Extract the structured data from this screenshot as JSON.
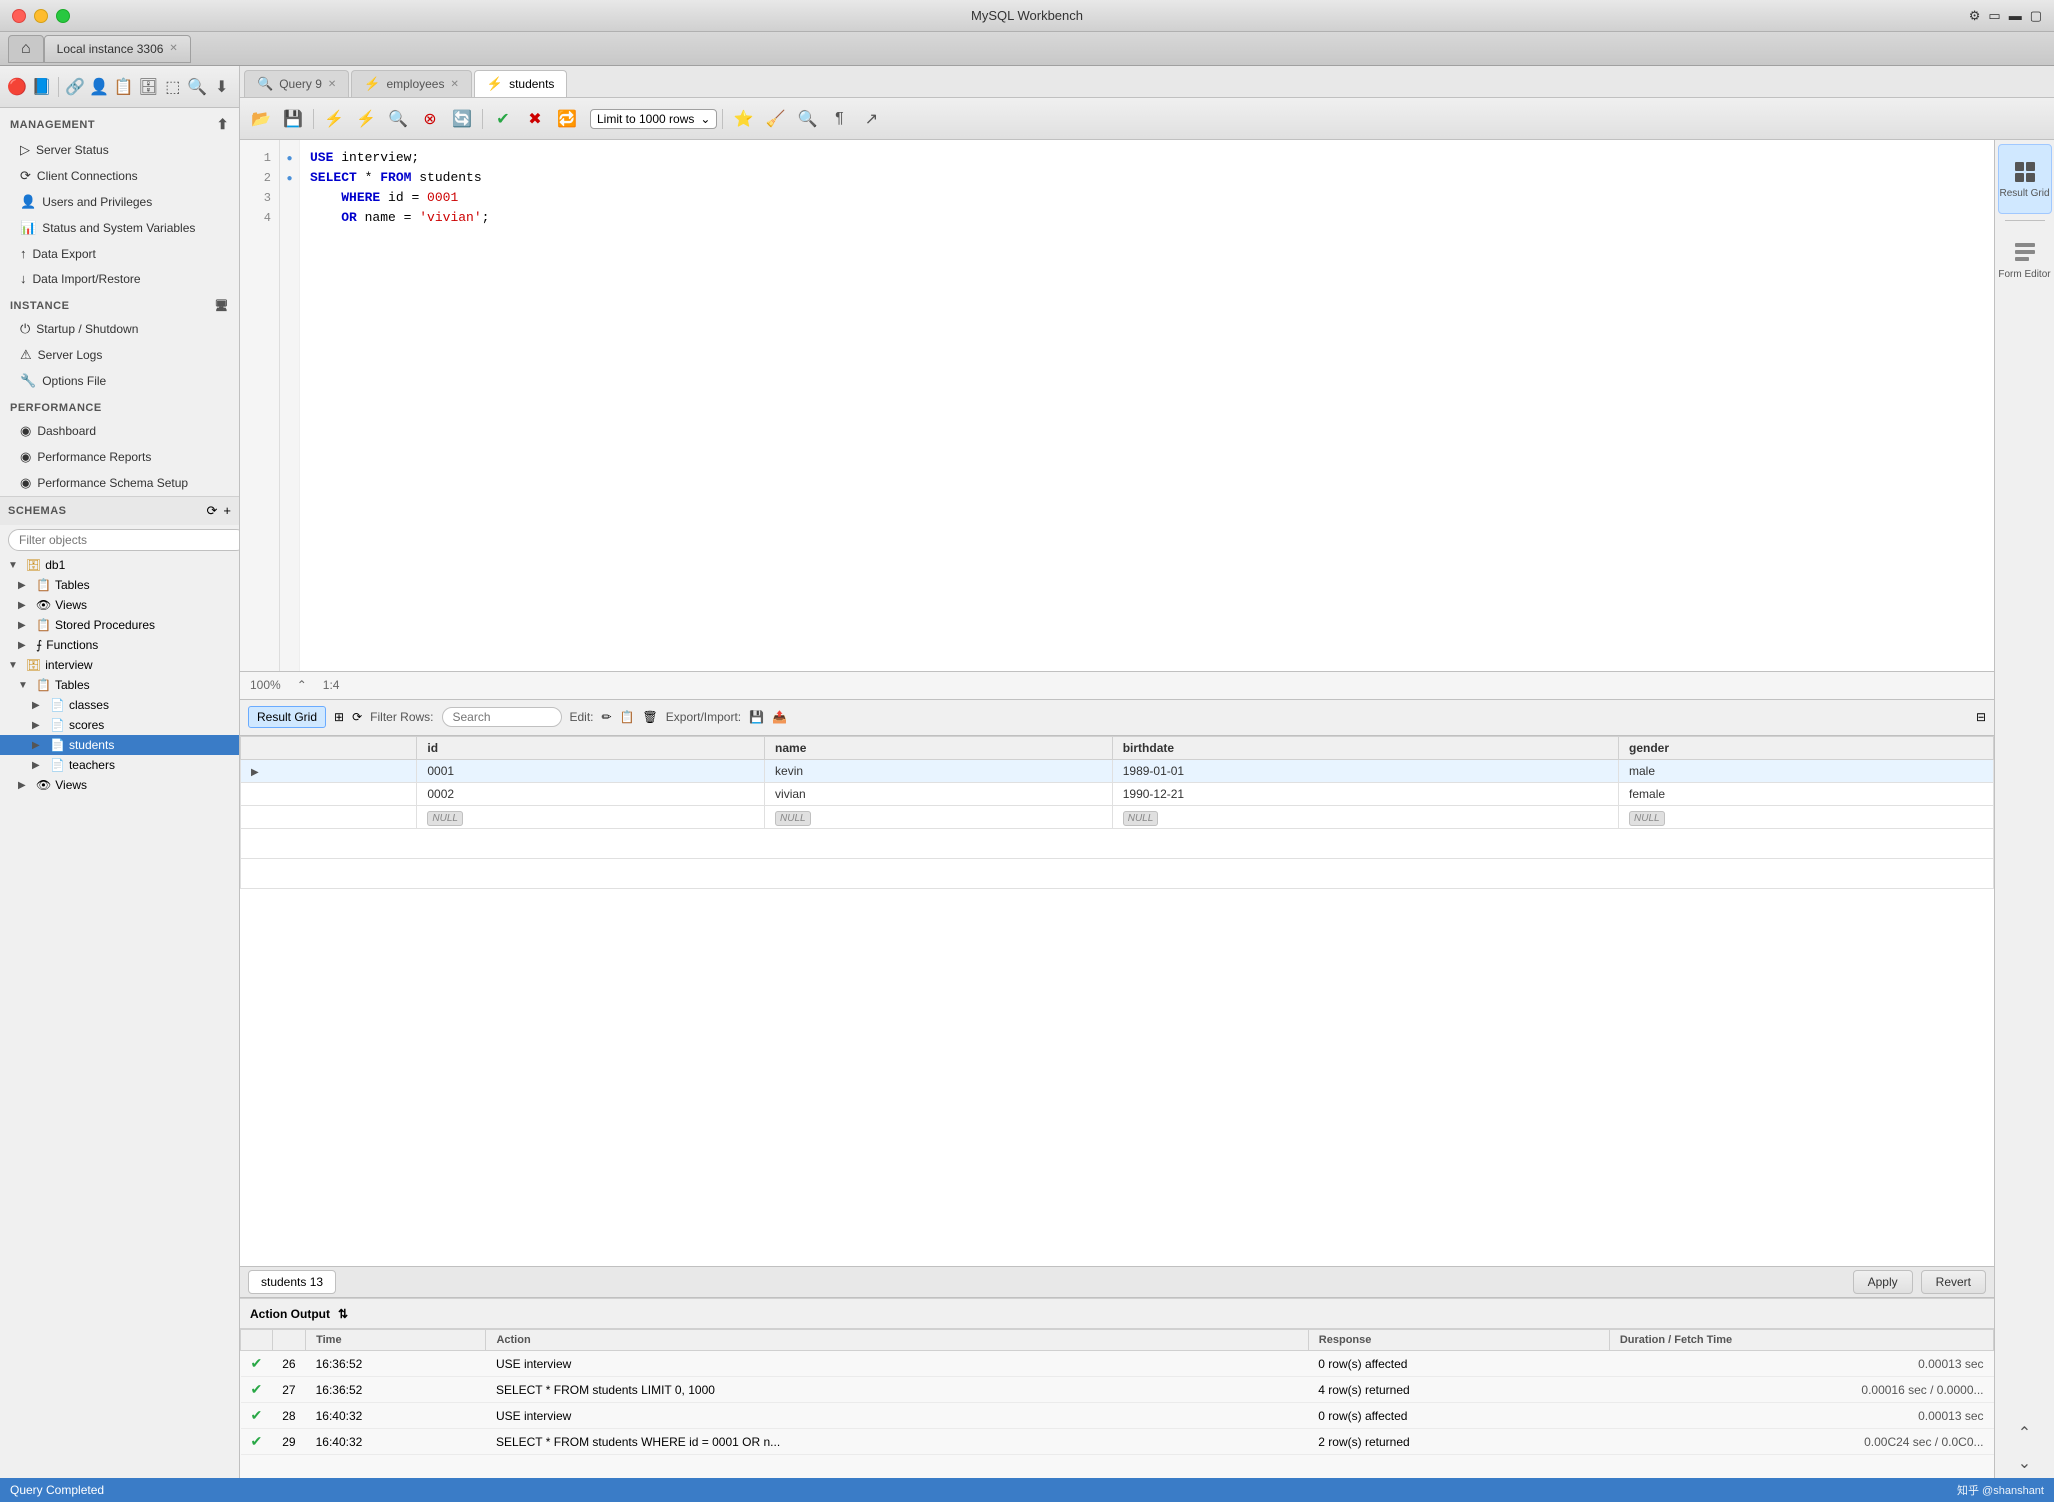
{
  "app": {
    "title": "MySQL Workbench",
    "window_tab": "Local instance 3306"
  },
  "sidebar": {
    "management_label": "MANAGEMENT",
    "management_items": [
      {
        "id": "server-status",
        "label": "Server Status",
        "icon": "●"
      },
      {
        "id": "client-connections",
        "label": "Client Connections",
        "icon": "⟳"
      },
      {
        "id": "users-privileges",
        "label": "Users and Privileges",
        "icon": "👤"
      },
      {
        "id": "status-system-vars",
        "label": "Status and System Variables",
        "icon": "📊"
      },
      {
        "id": "data-export",
        "label": "Data Export",
        "icon": "↑"
      },
      {
        "id": "data-import",
        "label": "Data Import/Restore",
        "icon": "↓"
      }
    ],
    "instance_label": "INSTANCE",
    "instance_items": [
      {
        "id": "startup-shutdown",
        "label": "Startup / Shutdown",
        "icon": "⏻"
      },
      {
        "id": "server-logs",
        "label": "Server Logs",
        "icon": "⚠"
      },
      {
        "id": "options-file",
        "label": "Options File",
        "icon": "🔧"
      }
    ],
    "performance_label": "PERFORMANCE",
    "performance_items": [
      {
        "id": "dashboard",
        "label": "Dashboard",
        "icon": "◉"
      },
      {
        "id": "performance-reports",
        "label": "Performance Reports",
        "icon": "◉"
      },
      {
        "id": "performance-schema",
        "label": "Performance Schema Setup",
        "icon": "◉"
      }
    ],
    "schemas_label": "SCHEMAS",
    "filter_placeholder": "Filter objects"
  },
  "schema_tree": [
    {
      "id": "db1",
      "label": "db1",
      "type": "database",
      "expanded": true,
      "children": [
        {
          "id": "db1-tables",
          "label": "Tables",
          "type": "folder",
          "expanded": false
        },
        {
          "id": "db1-views",
          "label": "Views",
          "type": "folder",
          "expanded": false
        },
        {
          "id": "db1-procedures",
          "label": "Stored Procedures",
          "type": "folder",
          "expanded": false
        },
        {
          "id": "db1-functions",
          "label": "Functions",
          "type": "folder",
          "expanded": false
        }
      ]
    },
    {
      "id": "interview",
      "label": "interview",
      "type": "database",
      "expanded": true,
      "children": [
        {
          "id": "interview-tables",
          "label": "Tables",
          "type": "folder",
          "expanded": true,
          "children": [
            {
              "id": "t-classes",
              "label": "classes",
              "type": "table"
            },
            {
              "id": "t-scores",
              "label": "scores",
              "type": "table"
            },
            {
              "id": "t-students",
              "label": "students",
              "type": "table",
              "selected": true
            },
            {
              "id": "t-teachers",
              "label": "teachers",
              "type": "table"
            }
          ]
        },
        {
          "id": "interview-views",
          "label": "Views",
          "type": "folder"
        }
      ]
    }
  ],
  "query_tabs": [
    {
      "id": "query9",
      "label": "Query 9",
      "closable": true,
      "active": false
    },
    {
      "id": "employees",
      "label": "employees",
      "closable": true,
      "active": false
    },
    {
      "id": "students",
      "label": "students",
      "closable": false,
      "active": true
    }
  ],
  "sql_code": {
    "lines": [
      {
        "n": 1,
        "dot": true,
        "text": "USE interview;"
      },
      {
        "n": 2,
        "dot": true,
        "text": "SELECT * FROM students"
      },
      {
        "n": 3,
        "dot": false,
        "text": "    WHERE id = 0001"
      },
      {
        "n": 4,
        "dot": false,
        "text": "    OR name = 'vivian';"
      }
    ]
  },
  "editor_status": {
    "zoom": "100%",
    "cursor": "1:4"
  },
  "result_grid": {
    "label": "Result Grid",
    "filter_label": "Filter Rows:",
    "search_placeholder": "Search",
    "edit_label": "Edit:",
    "export_label": "Export/Import:",
    "columns": [
      "id",
      "name",
      "birthdate",
      "gender"
    ],
    "rows": [
      {
        "arrow": true,
        "id": "0001",
        "name": "kevin",
        "birthdate": "1989-01-01",
        "gender": "male"
      },
      {
        "arrow": false,
        "id": "0002",
        "name": "vivian",
        "birthdate": "1990-12-21",
        "gender": "female"
      },
      {
        "arrow": false,
        "id": "NULL",
        "name": "NULL",
        "birthdate": "NULL",
        "gender": "NULL"
      }
    ]
  },
  "result_tabs": {
    "tabs": [
      "students 13"
    ],
    "apply_label": "Apply",
    "revert_label": "Revert"
  },
  "action_output": {
    "label": "Action Output",
    "columns": [
      "",
      "Time",
      "Action",
      "Response",
      "Duration / Fetch Time"
    ],
    "rows": [
      {
        "n": 26,
        "time": "16:36:52",
        "action": "USE interview",
        "response": "0 row(s) affected",
        "duration": "0.00013 sec"
      },
      {
        "n": 27,
        "time": "16:36:52",
        "action": "SELECT * FROM students LIMIT 0, 1000",
        "response": "4 row(s) returned",
        "duration": "0.00016 sec / 0.0000..."
      },
      {
        "n": 28,
        "time": "16:40:32",
        "action": "USE interview",
        "response": "0 row(s) affected",
        "duration": "0.00013 sec"
      },
      {
        "n": 29,
        "time": "16:40:32",
        "action": "SELECT * FROM students WHERE id = 0001  OR n...",
        "response": "2 row(s) returned",
        "duration": "0.00C24 sec / 0.0C0..."
      }
    ]
  },
  "right_panel": {
    "result_grid_label": "Result Grid",
    "form_editor_label": "Form Editor"
  },
  "status_bar": {
    "text": "Query Completed",
    "right": "知乎 @shanshant"
  },
  "toolbar": {
    "limit_label": "Limit to 1000 rows"
  }
}
